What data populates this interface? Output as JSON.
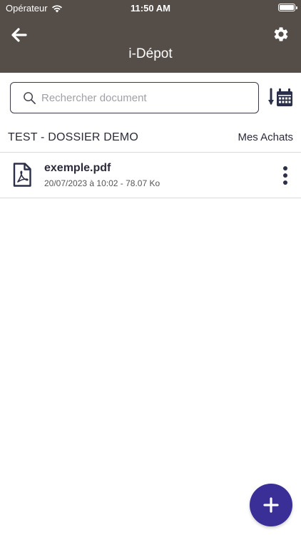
{
  "status_bar": {
    "carrier": "Opérateur",
    "time": "11:50 AM",
    "wifi_icon": "wifi-icon",
    "battery_icon": "battery-icon"
  },
  "header": {
    "title": "i-Dépot",
    "back_icon": "arrow-left-icon",
    "settings_icon": "gear-icon",
    "background_color": "#554d48"
  },
  "search": {
    "placeholder": "Rechercher document",
    "value": "",
    "icon": "search-icon"
  },
  "sort": {
    "icon": "sort-by-date-icon"
  },
  "folder": {
    "name": "TEST - DOSSIER DEMO",
    "link_label": "Mes Achats"
  },
  "files": [
    {
      "name": "exemple.pdf",
      "meta": "20/07/2023 à 10:02 - 78.07 Ko",
      "icon": "pdf-file-icon",
      "menu_icon": "more-vertical-icon"
    }
  ],
  "fab": {
    "icon": "plus-icon",
    "color": "#3a2f96"
  }
}
